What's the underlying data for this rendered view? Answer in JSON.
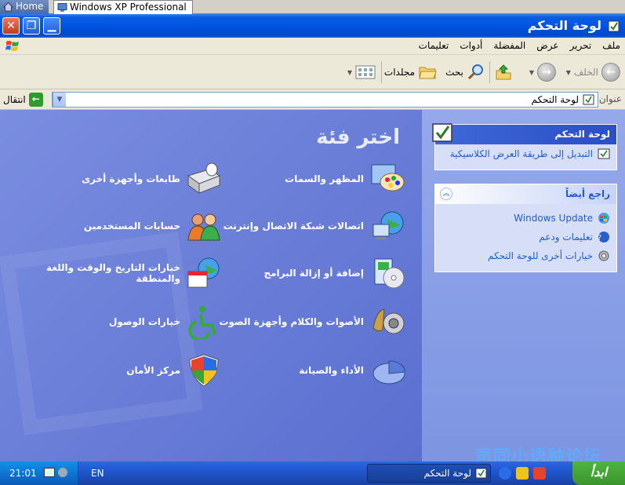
{
  "tabs": [
    {
      "label": "Home"
    },
    {
      "label": "Windows XP Professional"
    }
  ],
  "window": {
    "title": "لوحة التحكم"
  },
  "menu": [
    "ملف",
    "تحرير",
    "عرض",
    "المفضلة",
    "أدوات",
    "تعليمات"
  ],
  "toolbar": {
    "back_label": "الخلف",
    "search_label": "بحث",
    "folders_label": "مجلدات"
  },
  "address": {
    "label": "عنوان",
    "value": "لوحة التحكم",
    "go_label": "انتقال"
  },
  "main": {
    "title": "اختر فئة",
    "categories_right": [
      {
        "label": "المظهر والسمات",
        "icon": "appearance-icon"
      },
      {
        "label": "اتصالات شبكة الاتصال وإنترنت",
        "icon": "network-icon"
      },
      {
        "label": "إضافة أو إزالة البرامج",
        "icon": "add-remove-programs-icon"
      },
      {
        "label": "الأصوات والكلام وأجهزة الصوت",
        "icon": "sounds-icon"
      },
      {
        "label": "الأداء والصيانة",
        "icon": "performance-icon"
      }
    ],
    "categories_left": [
      {
        "label": "طابعات وأجهزة أخرى",
        "icon": "printer-icon"
      },
      {
        "label": "حسابات المستخدمين",
        "icon": "users-icon"
      },
      {
        "label": "خيارات التاريخ والوقت واللغة والمنطقة",
        "icon": "date-time-icon"
      },
      {
        "label": "خيارات الوصول",
        "icon": "accessibility-icon"
      },
      {
        "label": "مركز الأمان",
        "icon": "security-shield-icon"
      }
    ]
  },
  "side": {
    "panel1": {
      "title": "لوحة التحكم",
      "link": "التبديل إلى طريقة العرض الكلاسيكية"
    },
    "panel2": {
      "title": "راجع أيضاً",
      "links": [
        "Windows Update",
        "تعليمات ودعم",
        "خيارات أخرى للوحة التحكم"
      ]
    }
  },
  "taskbar": {
    "clock": "21:01",
    "lang": "EN",
    "task_label": "لوحة التحكم",
    "start_label": "ابدأ"
  },
  "watermark": "声同小语种论坛",
  "colors": {
    "title_blue": "#0054e3",
    "main_bg": "#6375d6",
    "link_blue": "#215dc6",
    "start_green": "#3b952d"
  }
}
